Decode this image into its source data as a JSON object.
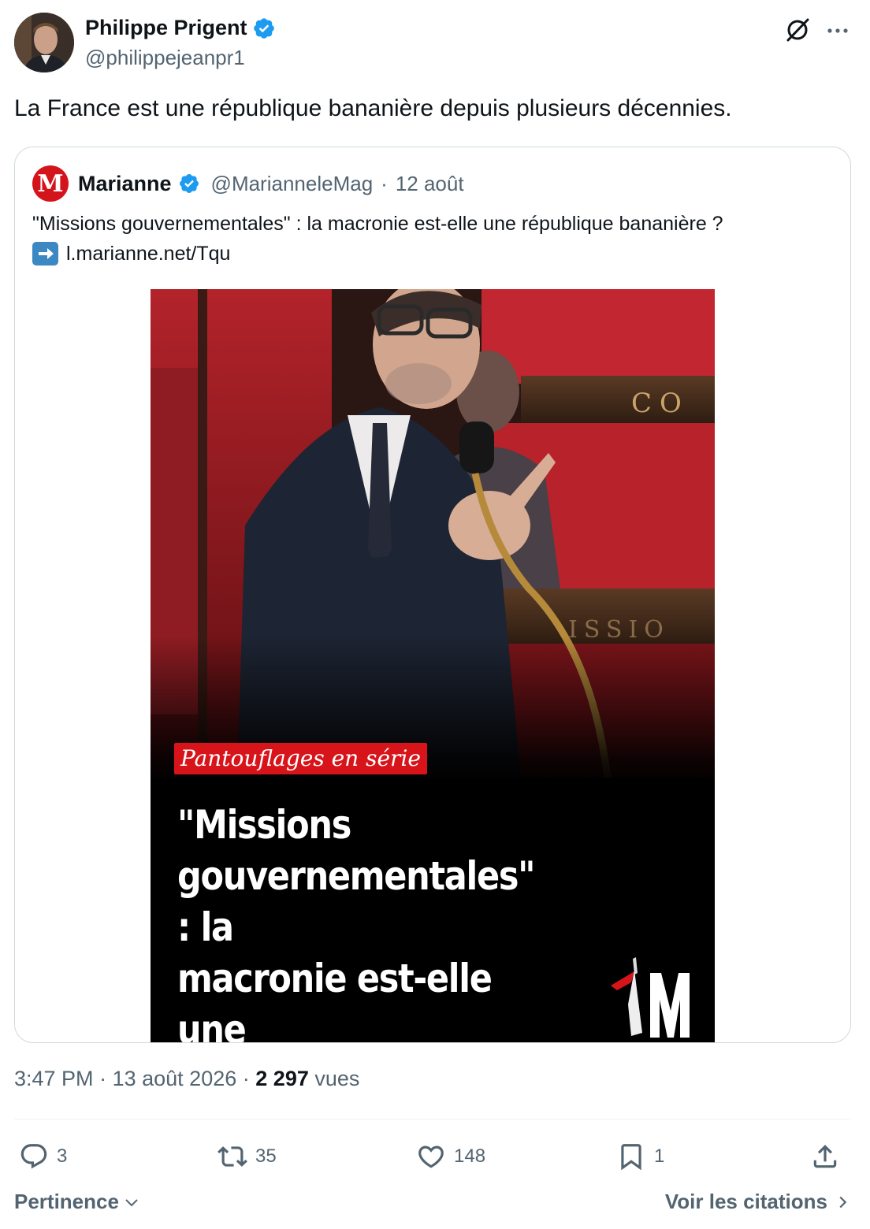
{
  "author": {
    "display_name": "Philippe Prigent",
    "handle": "@philippejeanpr1",
    "verified_icon": "verified-badge-icon"
  },
  "tweet": {
    "text": "La France est une république bananière depuis plusieurs décennies."
  },
  "quoted": {
    "display_name": "Marianne",
    "handle": "@MarianneleMag",
    "separator": "·",
    "date": "12 août",
    "text": "\"Missions gouvernementales\" : la macronie est-elle une république bananière ?",
    "link_icon": "right-arrow-emoji",
    "link": "l.marianne.net/Tqu",
    "image": {
      "kicker": "Pantouflages en série",
      "headline": "\"Missions\ngouvernementales\" : la\nmacronie est-elle une\nrépublique bananière ?",
      "bench_lettering_top": "CO",
      "bench_lettering_bottom": "ISSIO"
    }
  },
  "meta": {
    "time": "3:47 PM",
    "separator": "·",
    "date": "13 août 2026",
    "views_count": "2 297",
    "views_label": "vues"
  },
  "actions": {
    "replies": "3",
    "reposts": "35",
    "likes": "148",
    "bookmarks": "1"
  },
  "footer": {
    "sort_label": "Pertinence",
    "quotes_label": "Voir les citations"
  },
  "colors": {
    "text_primary": "#0f1419",
    "text_secondary": "#536471",
    "verified_blue": "#1d9bf0",
    "marianne_red": "#d4141c",
    "border": "#cfd9de"
  }
}
